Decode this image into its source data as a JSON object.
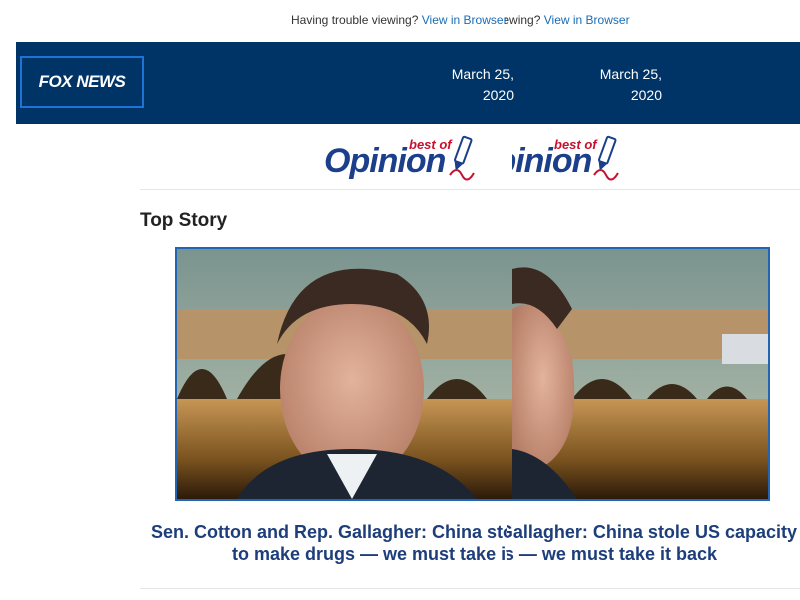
{
  "preheader": {
    "text": "Having trouble viewing?",
    "link": "View in Browser"
  },
  "header": {
    "logo": "FOX NEWS",
    "date_line1": "March 25,",
    "date_line2": "2020"
  },
  "banner": {
    "title": "Opinion",
    "kicker": "best of"
  },
  "section": {
    "title": "Top Story"
  },
  "story": {
    "headline_line1": "Sen. Cotton and Rep. Gallagher: China stole US capacity",
    "headline_line2": "to make drugs — we must take it back"
  },
  "colors": {
    "header_bg": "#003366",
    "link": "#1a6db5",
    "brand_red": "#c8102e",
    "headline": "#1d3e7a"
  }
}
